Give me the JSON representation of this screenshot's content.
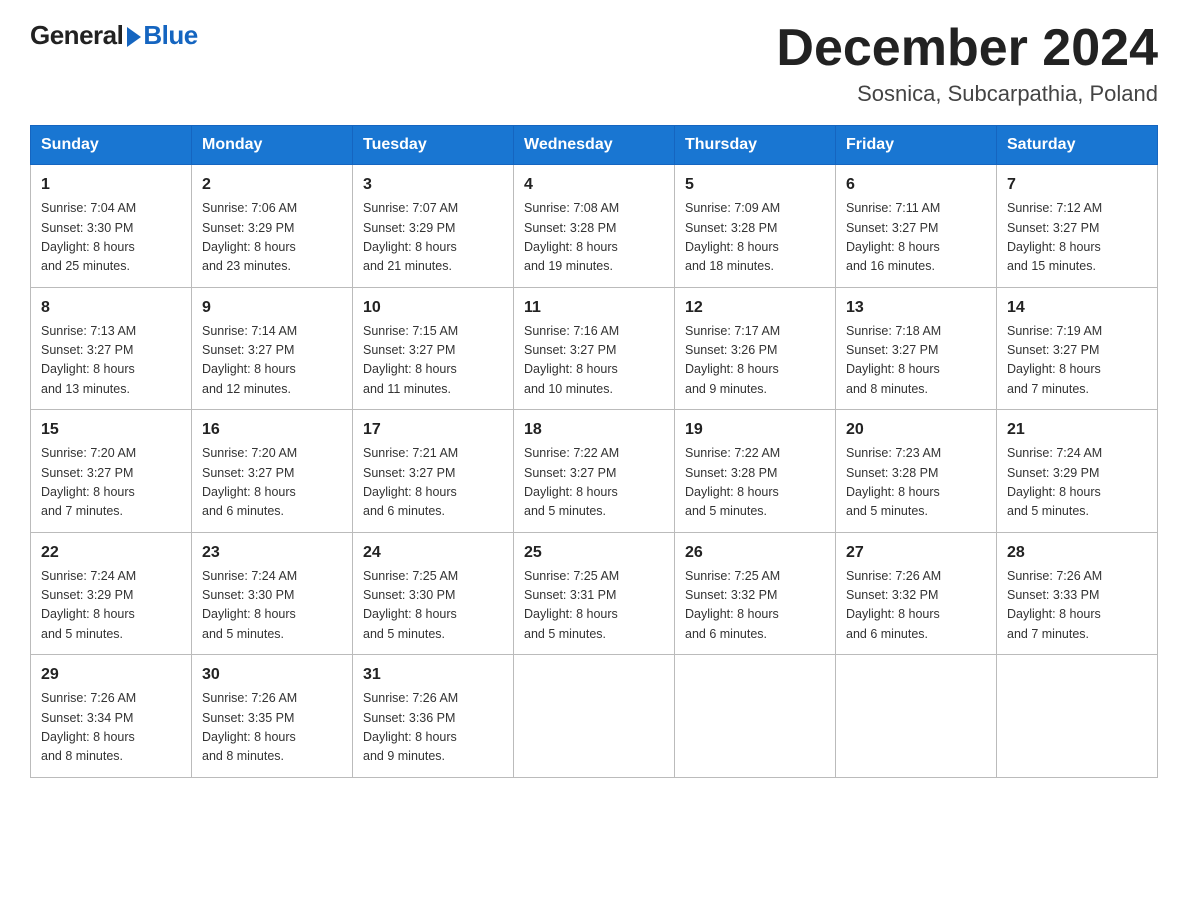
{
  "header": {
    "logo_general": "General",
    "logo_blue": "Blue",
    "month_title": "December 2024",
    "location": "Sosnica, Subcarpathia, Poland"
  },
  "days_of_week": [
    "Sunday",
    "Monday",
    "Tuesday",
    "Wednesday",
    "Thursday",
    "Friday",
    "Saturday"
  ],
  "weeks": [
    [
      {
        "num": "1",
        "info": "Sunrise: 7:04 AM\nSunset: 3:30 PM\nDaylight: 8 hours\nand 25 minutes."
      },
      {
        "num": "2",
        "info": "Sunrise: 7:06 AM\nSunset: 3:29 PM\nDaylight: 8 hours\nand 23 minutes."
      },
      {
        "num": "3",
        "info": "Sunrise: 7:07 AM\nSunset: 3:29 PM\nDaylight: 8 hours\nand 21 minutes."
      },
      {
        "num": "4",
        "info": "Sunrise: 7:08 AM\nSunset: 3:28 PM\nDaylight: 8 hours\nand 19 minutes."
      },
      {
        "num": "5",
        "info": "Sunrise: 7:09 AM\nSunset: 3:28 PM\nDaylight: 8 hours\nand 18 minutes."
      },
      {
        "num": "6",
        "info": "Sunrise: 7:11 AM\nSunset: 3:27 PM\nDaylight: 8 hours\nand 16 minutes."
      },
      {
        "num": "7",
        "info": "Sunrise: 7:12 AM\nSunset: 3:27 PM\nDaylight: 8 hours\nand 15 minutes."
      }
    ],
    [
      {
        "num": "8",
        "info": "Sunrise: 7:13 AM\nSunset: 3:27 PM\nDaylight: 8 hours\nand 13 minutes."
      },
      {
        "num": "9",
        "info": "Sunrise: 7:14 AM\nSunset: 3:27 PM\nDaylight: 8 hours\nand 12 minutes."
      },
      {
        "num": "10",
        "info": "Sunrise: 7:15 AM\nSunset: 3:27 PM\nDaylight: 8 hours\nand 11 minutes."
      },
      {
        "num": "11",
        "info": "Sunrise: 7:16 AM\nSunset: 3:27 PM\nDaylight: 8 hours\nand 10 minutes."
      },
      {
        "num": "12",
        "info": "Sunrise: 7:17 AM\nSunset: 3:26 PM\nDaylight: 8 hours\nand 9 minutes."
      },
      {
        "num": "13",
        "info": "Sunrise: 7:18 AM\nSunset: 3:27 PM\nDaylight: 8 hours\nand 8 minutes."
      },
      {
        "num": "14",
        "info": "Sunrise: 7:19 AM\nSunset: 3:27 PM\nDaylight: 8 hours\nand 7 minutes."
      }
    ],
    [
      {
        "num": "15",
        "info": "Sunrise: 7:20 AM\nSunset: 3:27 PM\nDaylight: 8 hours\nand 7 minutes."
      },
      {
        "num": "16",
        "info": "Sunrise: 7:20 AM\nSunset: 3:27 PM\nDaylight: 8 hours\nand 6 minutes."
      },
      {
        "num": "17",
        "info": "Sunrise: 7:21 AM\nSunset: 3:27 PM\nDaylight: 8 hours\nand 6 minutes."
      },
      {
        "num": "18",
        "info": "Sunrise: 7:22 AM\nSunset: 3:27 PM\nDaylight: 8 hours\nand 5 minutes."
      },
      {
        "num": "19",
        "info": "Sunrise: 7:22 AM\nSunset: 3:28 PM\nDaylight: 8 hours\nand 5 minutes."
      },
      {
        "num": "20",
        "info": "Sunrise: 7:23 AM\nSunset: 3:28 PM\nDaylight: 8 hours\nand 5 minutes."
      },
      {
        "num": "21",
        "info": "Sunrise: 7:24 AM\nSunset: 3:29 PM\nDaylight: 8 hours\nand 5 minutes."
      }
    ],
    [
      {
        "num": "22",
        "info": "Sunrise: 7:24 AM\nSunset: 3:29 PM\nDaylight: 8 hours\nand 5 minutes."
      },
      {
        "num": "23",
        "info": "Sunrise: 7:24 AM\nSunset: 3:30 PM\nDaylight: 8 hours\nand 5 minutes."
      },
      {
        "num": "24",
        "info": "Sunrise: 7:25 AM\nSunset: 3:30 PM\nDaylight: 8 hours\nand 5 minutes."
      },
      {
        "num": "25",
        "info": "Sunrise: 7:25 AM\nSunset: 3:31 PM\nDaylight: 8 hours\nand 5 minutes."
      },
      {
        "num": "26",
        "info": "Sunrise: 7:25 AM\nSunset: 3:32 PM\nDaylight: 8 hours\nand 6 minutes."
      },
      {
        "num": "27",
        "info": "Sunrise: 7:26 AM\nSunset: 3:32 PM\nDaylight: 8 hours\nand 6 minutes."
      },
      {
        "num": "28",
        "info": "Sunrise: 7:26 AM\nSunset: 3:33 PM\nDaylight: 8 hours\nand 7 minutes."
      }
    ],
    [
      {
        "num": "29",
        "info": "Sunrise: 7:26 AM\nSunset: 3:34 PM\nDaylight: 8 hours\nand 8 minutes."
      },
      {
        "num": "30",
        "info": "Sunrise: 7:26 AM\nSunset: 3:35 PM\nDaylight: 8 hours\nand 8 minutes."
      },
      {
        "num": "31",
        "info": "Sunrise: 7:26 AM\nSunset: 3:36 PM\nDaylight: 8 hours\nand 9 minutes."
      },
      null,
      null,
      null,
      null
    ]
  ]
}
